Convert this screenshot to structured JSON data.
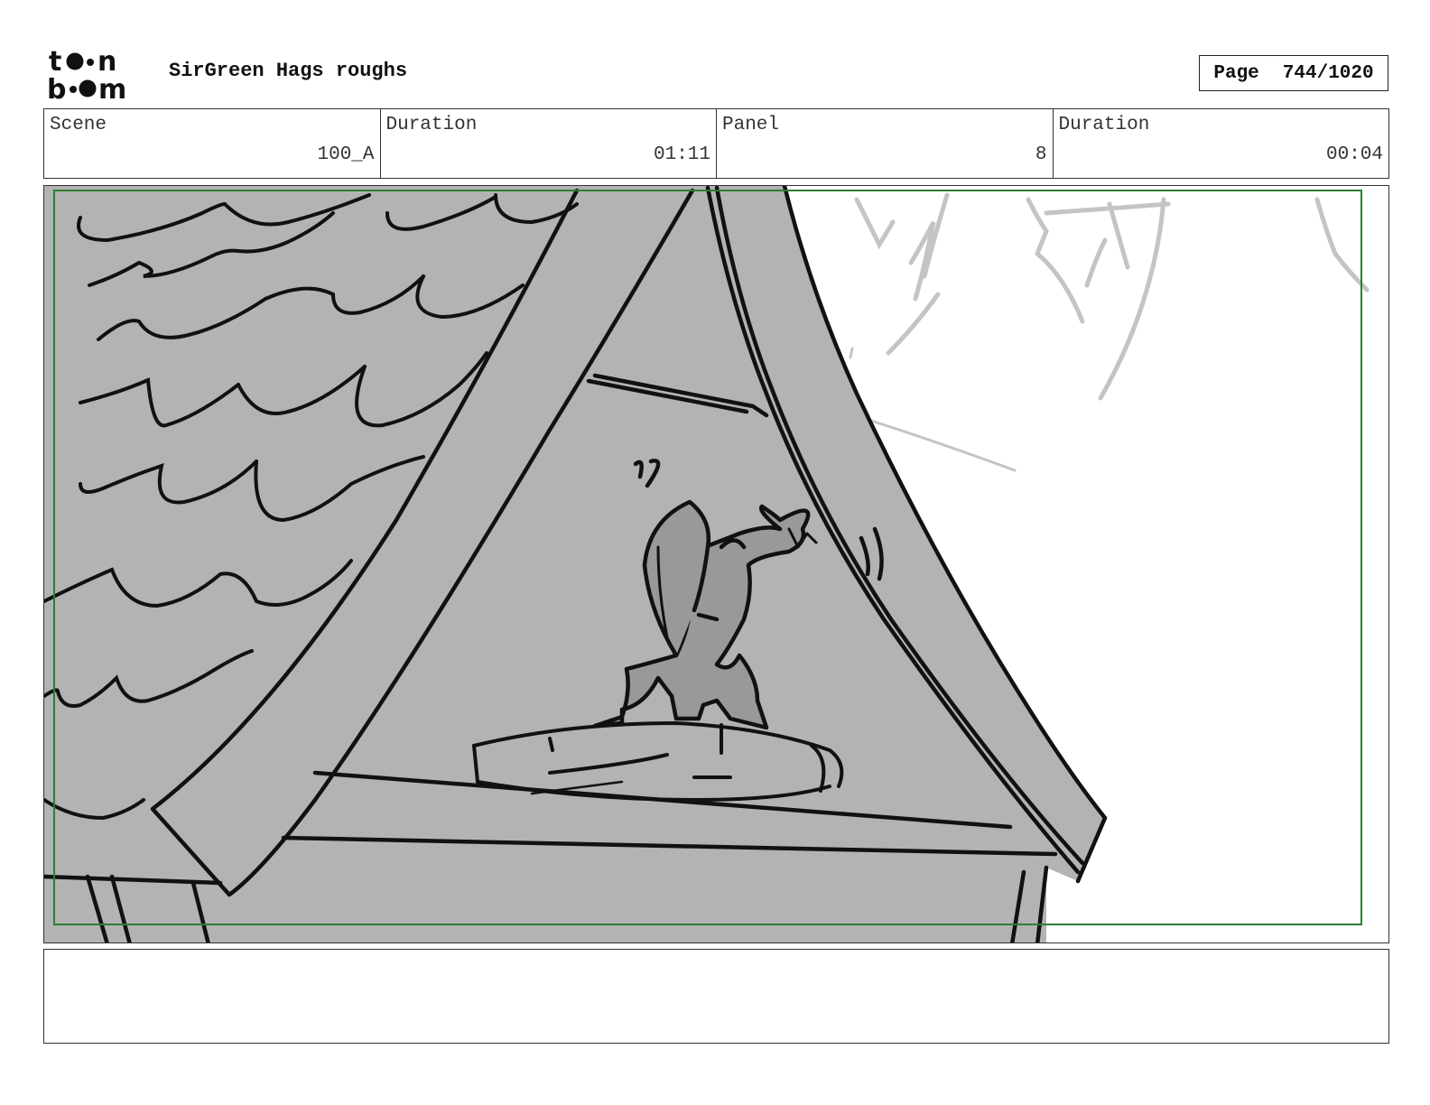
{
  "header": {
    "logo_text_top": "toon",
    "logo_text_bottom": "boom",
    "project_title": "SirGreen Hags roughs",
    "page_label": "Page",
    "page_number": "744/1020"
  },
  "info": {
    "scene_label": "Scene",
    "scene_value": "100_A",
    "scene_duration_label": "Duration",
    "scene_duration_value": "01:11",
    "panel_label": "Panel",
    "panel_value": "8",
    "panel_duration_label": "Duration",
    "panel_duration_value": "00:04"
  },
  "panel": {
    "safe_frame_color": "#2e7d32",
    "fill_color": "#b3b3b3",
    "statue_color": "#999999"
  },
  "notes": {
    "text": ""
  }
}
